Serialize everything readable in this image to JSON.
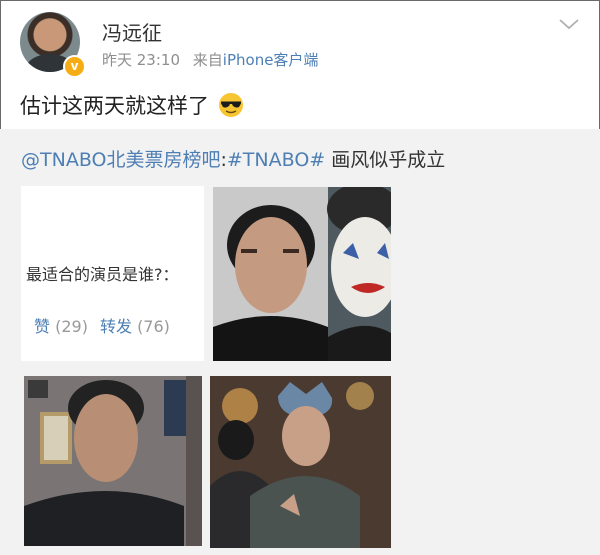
{
  "user": {
    "name": "冯远征",
    "time": "昨天 23:10",
    "source_prefix": "来自",
    "source": "iPhone客户端",
    "verified_badge": "v"
  },
  "post": {
    "text": "估计这两天就这样了",
    "emoji": "sunglasses-face"
  },
  "repost": {
    "mention": "@TNABO北美票房榜吧",
    "sep": ":",
    "hashtag": "#TNABO#",
    "text": " 画风似乎成立",
    "card": {
      "question": "最适合的演员是谁?：",
      "like_label": "赞",
      "like_count": "(29)",
      "repost_label": "转发",
      "repost_count": "(76)"
    }
  },
  "icons": {
    "menu": "chevron-down-icon"
  },
  "colors": {
    "link": "#4d7fb4",
    "meta": "#8e8e8e",
    "badge": "#f6ad15",
    "repost_bg": "#f2f2f2"
  }
}
